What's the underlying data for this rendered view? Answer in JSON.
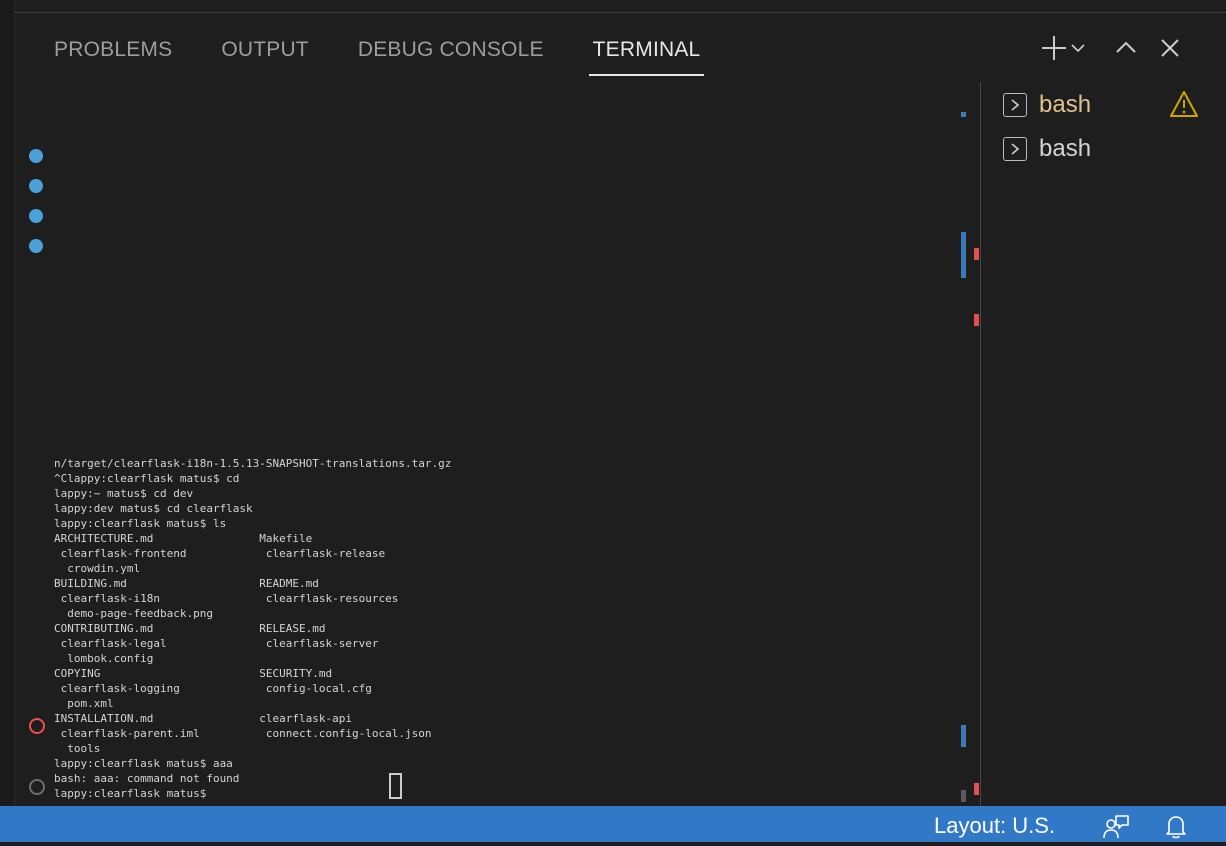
{
  "panel": {
    "tabs": [
      {
        "label": "PROBLEMS",
        "active": false
      },
      {
        "label": "OUTPUT",
        "active": false
      },
      {
        "label": "DEBUG CONSOLE",
        "active": false
      },
      {
        "label": "TERMINAL",
        "active": true
      }
    ],
    "actions": [
      "plus-icon",
      "chevron-down-icon",
      "chevron-up-icon",
      "close-icon"
    ]
  },
  "terminal": {
    "lines": [
      "n/target/clearflask-i18n-1.5.13-SNAPSHOT-translations.tar.gz",
      "^Clappy:clearflask matus$ cd",
      "lappy:~ matus$ cd dev",
      "lappy:dev matus$ cd clearflask",
      "lappy:clearflask matus$ ls",
      "ARCHITECTURE.md                Makefile",
      " clearflask-frontend            clearflask-release",
      "  crowdin.yml",
      "BUILDING.md                    README.md",
      " clearflask-i18n                clearflask-resources",
      "  demo-page-feedback.png",
      "CONTRIBUTING.md                RELEASE.md",
      " clearflask-legal               clearflask-server",
      "  lombok.config",
      "COPYING                        SECURITY.md",
      " clearflask-logging             config-local.cfg",
      "  pom.xml",
      "INSTALLATION.md                clearflask-api",
      " clearflask-parent.iml          connect.config-local.json",
      "  tools",
      "lappy:clearflask matus$ aaa",
      "bash: aaa: command not found",
      "lappy:clearflask matus$"
    ]
  },
  "sidebar": {
    "items": [
      {
        "label": "bash",
        "icon": "terminal-icon",
        "warning": true
      },
      {
        "label": "bash",
        "icon": "terminal-icon",
        "warning": false
      }
    ]
  },
  "status_bar": {
    "layout_label": "Layout: U.S.",
    "icons": [
      "feedback-icon",
      "bell-icon"
    ]
  },
  "colors": {
    "accent_blue": "#3178c6",
    "decoration_blue": "#4aa0d8",
    "error_red": "#f14c4c",
    "warning_yellow": "#cca700"
  }
}
